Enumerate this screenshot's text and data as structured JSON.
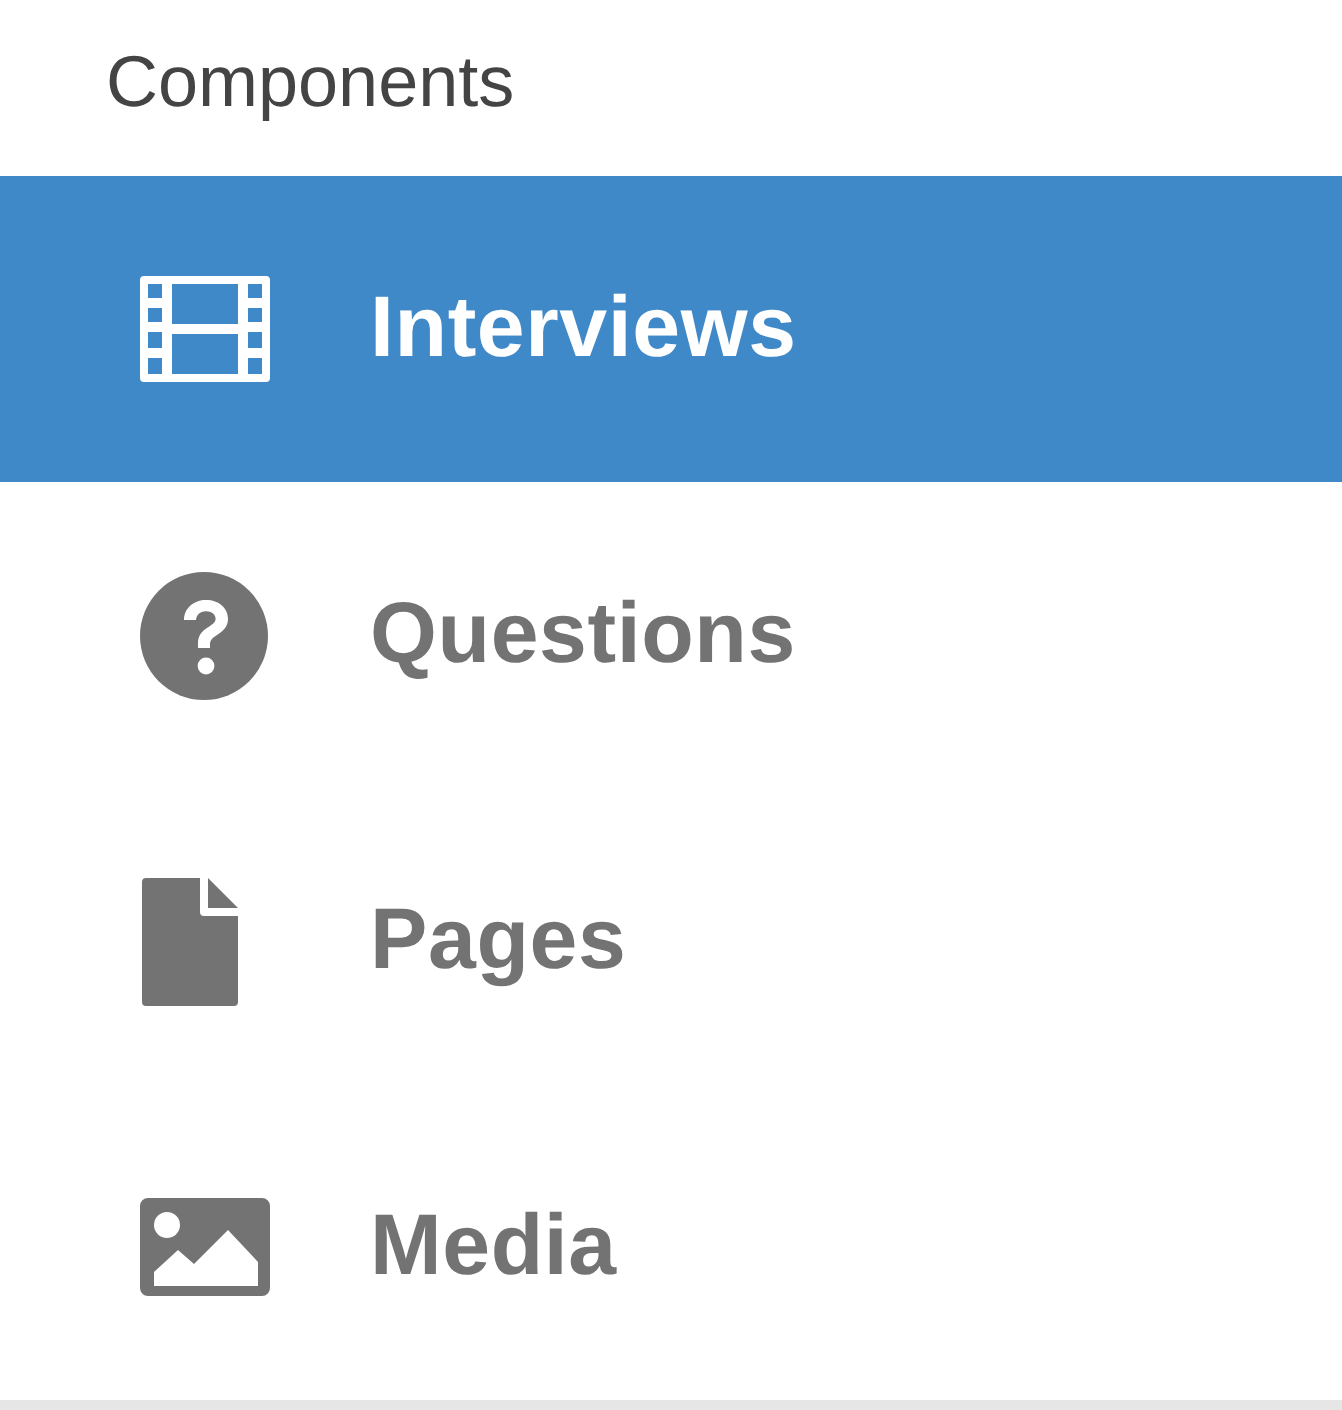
{
  "header": {
    "title": "Components"
  },
  "nav": {
    "items": [
      {
        "kind": "film",
        "label": "Interviews",
        "selected": true
      },
      {
        "kind": "question",
        "label": "Questions",
        "selected": false
      },
      {
        "kind": "file",
        "label": "Pages",
        "selected": false
      },
      {
        "kind": "image",
        "label": "Media",
        "selected": false
      }
    ]
  }
}
